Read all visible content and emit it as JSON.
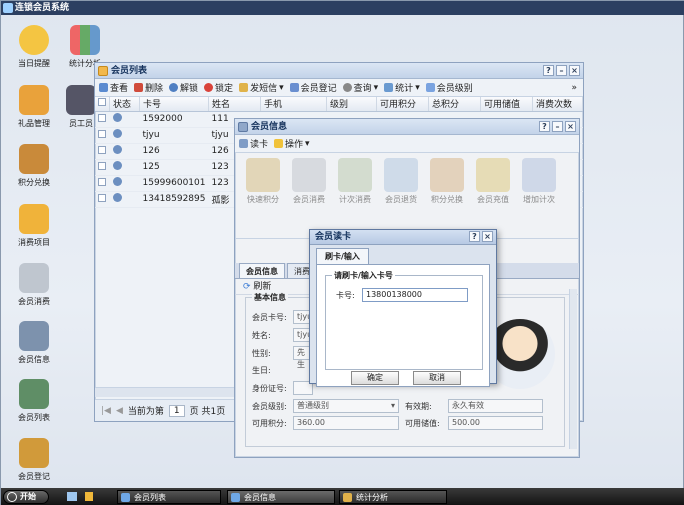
{
  "app": {
    "title": "连锁会员系统"
  },
  "desktop": {
    "icons": [
      {
        "label": "当日提醒"
      },
      {
        "label": "统计分析"
      },
      {
        "label": "礼品管理"
      },
      {
        "label": "员工员"
      },
      {
        "label": "积分兑换"
      },
      {
        "label": "消费项目"
      },
      {
        "label": "会员消费"
      },
      {
        "label": "会员信息"
      },
      {
        "label": "会员列表"
      },
      {
        "label": "会员登记"
      }
    ]
  },
  "member_list": {
    "title": "会员列表",
    "toolbar": [
      "查看",
      "删除",
      "解锁",
      "锁定",
      "发短信",
      "会员登记",
      "查询",
      "统计",
      "会员级别"
    ],
    "columns": [
      "状态",
      "卡号",
      "姓名",
      "手机",
      "级别",
      "可用积分",
      "总积分",
      "可用储值",
      "消费次数"
    ],
    "rows": [
      {
        "card": "1592000",
        "name": "111"
      },
      {
        "card": "tjyu",
        "name": "tjyu"
      },
      {
        "card": "126",
        "name": "126"
      },
      {
        "card": "125",
        "name": "123"
      },
      {
        "card": "15999600101",
        "name": "123"
      },
      {
        "card": "13418592895",
        "name": "孤影"
      }
    ],
    "footer": {
      "current_label": "当前为第",
      "page": "1",
      "suffix": "页 共1页"
    }
  },
  "member_info": {
    "title": "会员信息",
    "toolbar": [
      "读卡",
      "操作"
    ],
    "functions": [
      "快速积分",
      "会员消费",
      "计次消费",
      "会员退货",
      "积分兑换",
      "会员充值",
      "增加计次"
    ],
    "tabs": [
      "会员信息",
      "消费"
    ],
    "refresh_label": "刷新",
    "section_title": "基本信息",
    "fields": {
      "card_label": "会员卡号:",
      "card_value": "tjyu",
      "name_label": "姓名:",
      "name_value": "tjyu",
      "gender_label": "性别:",
      "gender_value": "先生",
      "birthday_label": "生日:",
      "id_label": "身份证号:",
      "level_label": "会员级别:",
      "level_value": "普通级别",
      "valid_label": "有效期:",
      "valid_value": "永久有效",
      "points_label": "可用积分:",
      "points_value": "360.00",
      "stored_label": "可用储值:",
      "stored_value": "500.00"
    }
  },
  "dialog": {
    "title": "会员读卡",
    "tab": "刷卡/输入",
    "group_title": "请刷卡/输入卡号",
    "card_label": "卡号:",
    "card_value": "13800138000",
    "ok": "确定",
    "cancel": "取消"
  },
  "taskbar": {
    "start": "开始",
    "items": [
      "会员列表",
      "会员信息",
      "统计分析"
    ]
  }
}
